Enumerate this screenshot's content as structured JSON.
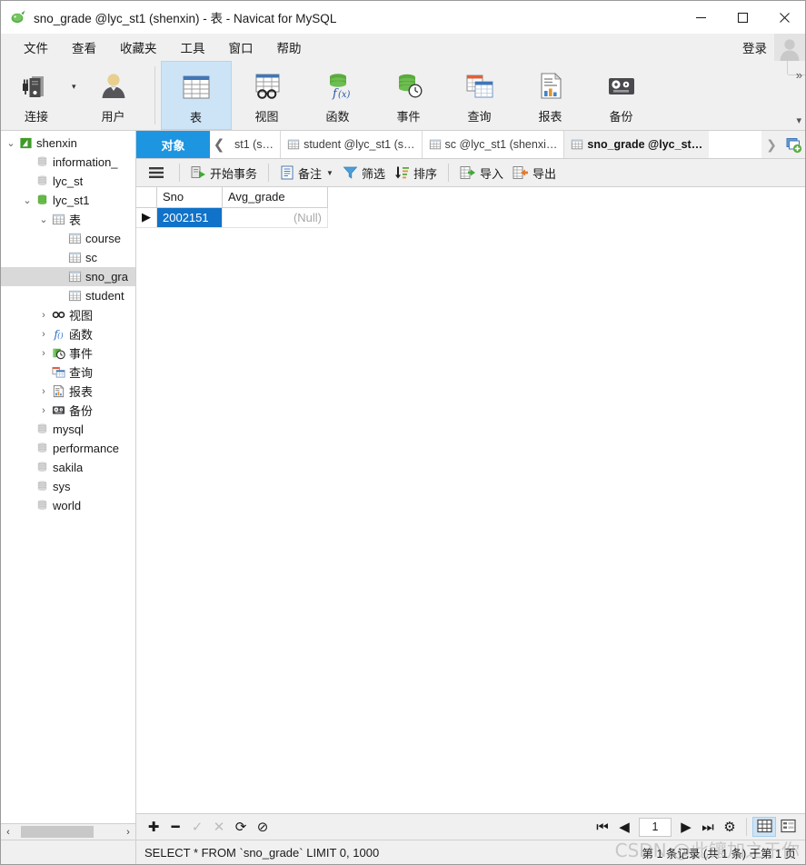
{
  "window": {
    "title": "sno_grade @lyc_st1 (shenxin) - 表 - Navicat for MySQL",
    "minimize": "—",
    "maximize": "☐",
    "close": "✕"
  },
  "menubar": {
    "items": [
      {
        "label": "文件"
      },
      {
        "label": "查看"
      },
      {
        "label": "收藏夹"
      },
      {
        "label": "工具"
      },
      {
        "label": "窗口"
      },
      {
        "label": "帮助"
      }
    ],
    "login_label": "登录"
  },
  "ribbon": {
    "left": [
      {
        "label": "连接",
        "icon": "connection-icon"
      },
      {
        "label": "用户",
        "icon": "user-icon"
      }
    ],
    "right": [
      {
        "label": "表",
        "icon": "table-icon",
        "selected": true
      },
      {
        "label": "视图",
        "icon": "view-icon",
        "selected": false
      },
      {
        "label": "函数",
        "icon": "function-icon",
        "selected": false
      },
      {
        "label": "事件",
        "icon": "event-icon",
        "selected": false
      },
      {
        "label": "查询",
        "icon": "query-icon",
        "selected": false
      },
      {
        "label": "报表",
        "icon": "report-icon",
        "selected": false
      },
      {
        "label": "备份",
        "icon": "backup-icon",
        "selected": false
      }
    ],
    "expand_more": "»",
    "expand_down": "▾"
  },
  "sidebar": {
    "items": [
      {
        "label": "shenxin",
        "indent": 0,
        "twisty": "v",
        "icon": "connection-green-icon",
        "selected": false
      },
      {
        "label": "information_",
        "indent": 1,
        "twisty": "",
        "icon": "db-gray-icon",
        "selected": false
      },
      {
        "label": "lyc_st",
        "indent": 1,
        "twisty": "",
        "icon": "db-gray-icon",
        "selected": false
      },
      {
        "label": "lyc_st1",
        "indent": 1,
        "twisty": "v",
        "icon": "db-green-icon",
        "selected": false
      },
      {
        "label": "表",
        "indent": 2,
        "twisty": "v",
        "icon": "table-icon",
        "selected": false
      },
      {
        "label": "course",
        "indent": 3,
        "twisty": "",
        "icon": "table-icon",
        "selected": false
      },
      {
        "label": "sc",
        "indent": 3,
        "twisty": "",
        "icon": "table-icon",
        "selected": false
      },
      {
        "label": "sno_gra",
        "indent": 3,
        "twisty": "",
        "icon": "table-icon",
        "selected": true
      },
      {
        "label": "student",
        "indent": 3,
        "twisty": "",
        "icon": "table-icon",
        "selected": false
      },
      {
        "label": "视图",
        "indent": 2,
        "twisty": ">",
        "icon": "view-icon",
        "selected": false
      },
      {
        "label": "函数",
        "indent": 2,
        "twisty": ">",
        "icon": "function-icon",
        "selected": false
      },
      {
        "label": "事件",
        "indent": 2,
        "twisty": ">",
        "icon": "event-icon",
        "selected": false
      },
      {
        "label": "查询",
        "indent": 2,
        "twisty": "",
        "icon": "query-icon",
        "selected": false
      },
      {
        "label": "报表",
        "indent": 2,
        "twisty": ">",
        "icon": "report-icon",
        "selected": false
      },
      {
        "label": "备份",
        "indent": 2,
        "twisty": ">",
        "icon": "backup-icon",
        "selected": false
      },
      {
        "label": "mysql",
        "indent": 1,
        "twisty": "",
        "icon": "db-gray-icon",
        "selected": false
      },
      {
        "label": "performance",
        "indent": 1,
        "twisty": "",
        "icon": "db-gray-icon",
        "selected": false
      },
      {
        "label": "sakila",
        "indent": 1,
        "twisty": "",
        "icon": "db-gray-icon",
        "selected": false
      },
      {
        "label": "sys",
        "indent": 1,
        "twisty": "",
        "icon": "db-gray-icon",
        "selected": false
      },
      {
        "label": "world",
        "indent": 1,
        "twisty": "",
        "icon": "db-gray-icon",
        "selected": false
      }
    ],
    "scroll_left": "‹",
    "scroll_right": "›"
  },
  "tabstrip": {
    "objects_tab": "对象",
    "nav_left": "❮",
    "nav_right": "❯",
    "tabs": [
      {
        "label": "st1 (s…",
        "active": false
      },
      {
        "label": "student @lyc_st1 (s…",
        "active": false
      },
      {
        "label": "sc @lyc_st1 (shenxi…",
        "active": false
      },
      {
        "label": "sno_grade @lyc_st…",
        "active": true
      }
    ]
  },
  "gridbar": {
    "menu_icon": "hamburger-icon",
    "buttons": [
      {
        "label": "开始事务",
        "icon": "begin-transaction-icon",
        "caret": false
      },
      {
        "label": "备注",
        "icon": "note-icon",
        "caret": true
      },
      {
        "label": "筛选",
        "icon": "filter-icon",
        "caret": false
      },
      {
        "label": "排序",
        "icon": "sort-icon",
        "caret": false
      },
      {
        "label": "导入",
        "icon": "import-icon",
        "caret": false
      },
      {
        "label": "导出",
        "icon": "export-icon",
        "caret": false
      }
    ]
  },
  "grid": {
    "columns": [
      "Sno",
      "Avg_grade"
    ],
    "rows": [
      {
        "marker": "▶",
        "cells": [
          "2002151",
          "(Null)"
        ],
        "selected_cell": 0,
        "null_cells": [
          1
        ]
      }
    ]
  },
  "bottombar": {
    "actions": [
      {
        "icon": "plus-icon",
        "glyph": "✚",
        "enabled": true
      },
      {
        "icon": "minus-icon",
        "glyph": "━",
        "enabled": true
      },
      {
        "icon": "check-icon",
        "glyph": "✓",
        "enabled": false
      },
      {
        "icon": "cancel-icon",
        "glyph": "✕",
        "enabled": false
      },
      {
        "icon": "refresh-icon",
        "glyph": "⟳",
        "enabled": true
      },
      {
        "icon": "stop-icon",
        "glyph": "⊘",
        "enabled": true
      }
    ],
    "nav": {
      "first": "⏮",
      "prev": "◀",
      "page_value": "1",
      "next": "▶",
      "last": "⏭",
      "settings": "⚙"
    },
    "view_grid": "grid-view-icon",
    "view_form": "form-view-icon"
  },
  "statusbar": {
    "sql": "SELECT * FROM `sno_grade` LIMIT 0, 1000",
    "record_info": "第 1 条记录 (共 1 条) 于第 1 页",
    "watermark": "CSDN @此镶加之于你"
  },
  "colors": {
    "accent_blue": "#1e95e0",
    "selection_blue": "#1072c8",
    "ribbon_selected": "#cde4f7",
    "green": "#4a9a3f",
    "orange": "#e8792a"
  }
}
